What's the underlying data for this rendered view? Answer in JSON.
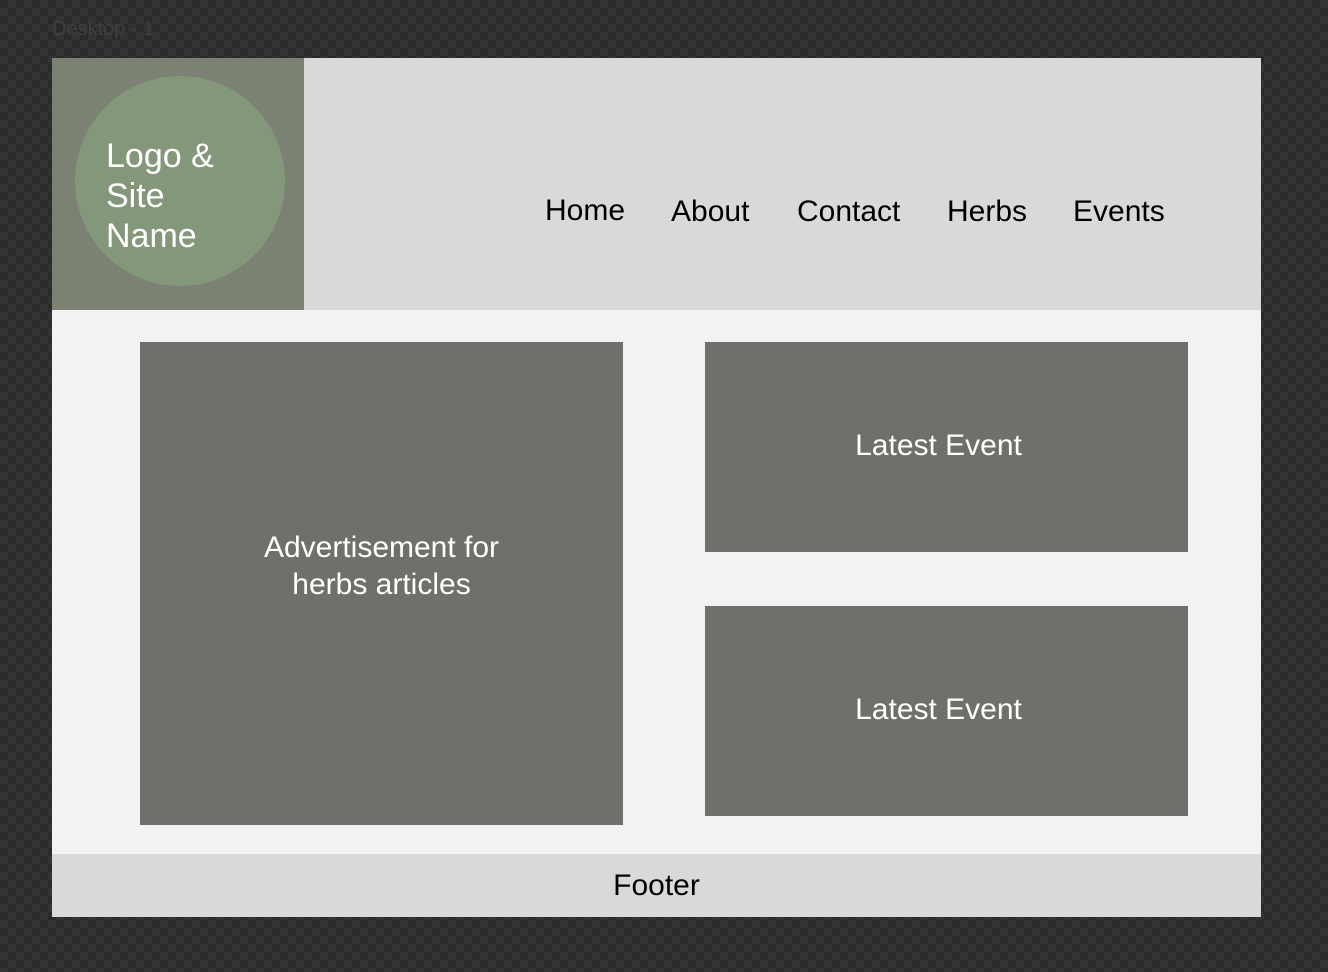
{
  "canvas": {
    "frame_label": "Desktop - 1"
  },
  "header": {
    "logo_text": "Logo & Site Name",
    "nav": [
      {
        "label": "Home"
      },
      {
        "label": "About"
      },
      {
        "label": "Contact"
      },
      {
        "label": "Herbs"
      },
      {
        "label": "Events"
      }
    ]
  },
  "main": {
    "advertisement": "Advertisement for herbs articles",
    "events": [
      {
        "label": "Latest Event"
      },
      {
        "label": "Latest Event"
      }
    ]
  },
  "footer": {
    "label": "Footer"
  },
  "colors": {
    "page_background": "#f3f1f2",
    "header_background": "#d9d9d9",
    "logo_block": "#7b8173",
    "logo_circle": "#85977a",
    "panel": "#6e706a",
    "footer_background": "#d9d9d9"
  }
}
